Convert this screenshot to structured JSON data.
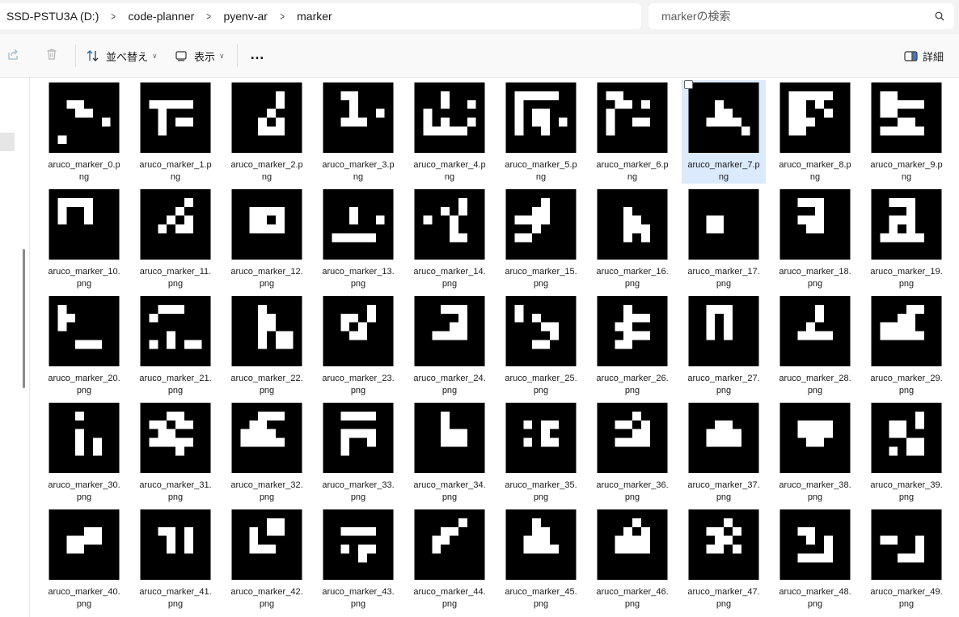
{
  "breadcrumb": [
    "SSD-PSTU3A (D:)",
    "code-planner",
    "pyenv-ar",
    "marker"
  ],
  "search": {
    "placeholder": "markerの検索"
  },
  "toolbar": {
    "sort_label": "並べ替え",
    "view_label": "表示",
    "more_label": "…",
    "details_label": "詳細"
  },
  "icons": {
    "share": "share-icon",
    "delete": "trash-icon",
    "sort": "sort-arrows-icon",
    "view": "view-icon",
    "details": "details-pane-icon",
    "search": "search-icon"
  },
  "selected_index": 7,
  "files": [
    {
      "line1": "aruco_marker_0.p",
      "line2": "ng",
      "g": "0000000000011000001100000001000000100000000000000000"
    },
    {
      "line1": "aruco_marker_1.p",
      "line2": "ng",
      "g": ""
    },
    {
      "line1": "aruco_marker_2.p",
      "line2": "ng",
      "g": ""
    },
    {
      "line1": "aruco_marker_3.p",
      "line2": "ng",
      "g": ""
    },
    {
      "line1": "aruco_marker_4.p",
      "line2": "ng",
      "g": ""
    },
    {
      "line1": "aruco_marker_5.p",
      "line2": "ng",
      "g": ""
    },
    {
      "line1": "aruco_marker_6.p",
      "line2": "ng",
      "g": ""
    },
    {
      "line1": "aruco_marker_7.p",
      "line2": "ng",
      "g": ""
    },
    {
      "line1": "aruco_marker_8.p",
      "line2": "ng",
      "g": ""
    },
    {
      "line1": "aruco_marker_9.p",
      "line2": "ng",
      "g": ""
    },
    {
      "line1": "aruco_marker_10.",
      "line2": "png",
      "g": ""
    },
    {
      "line1": "aruco_marker_11.",
      "line2": "png",
      "g": ""
    },
    {
      "line1": "aruco_marker_12.",
      "line2": "png",
      "g": ""
    },
    {
      "line1": "aruco_marker_13.",
      "line2": "png",
      "g": ""
    },
    {
      "line1": "aruco_marker_14.",
      "line2": "png",
      "g": ""
    },
    {
      "line1": "aruco_marker_15.",
      "line2": "png",
      "g": ""
    },
    {
      "line1": "aruco_marker_16.",
      "line2": "png",
      "g": ""
    },
    {
      "line1": "aruco_marker_17.",
      "line2": "png",
      "g": ""
    },
    {
      "line1": "aruco_marker_18.",
      "line2": "png",
      "g": ""
    },
    {
      "line1": "aruco_marker_19.",
      "line2": "png",
      "g": ""
    },
    {
      "line1": "aruco_marker_20.",
      "line2": "png",
      "g": ""
    },
    {
      "line1": "aruco_marker_21.",
      "line2": "png",
      "g": ""
    },
    {
      "line1": "aruco_marker_22.",
      "line2": "png",
      "g": ""
    },
    {
      "line1": "aruco_marker_23.",
      "line2": "png",
      "g": ""
    },
    {
      "line1": "aruco_marker_24.",
      "line2": "png",
      "g": ""
    },
    {
      "line1": "aruco_marker_25.",
      "line2": "png",
      "g": ""
    },
    {
      "line1": "aruco_marker_26.",
      "line2": "png",
      "g": ""
    },
    {
      "line1": "aruco_marker_27.",
      "line2": "png",
      "g": ""
    },
    {
      "line1": "aruco_marker_28.",
      "line2": "png",
      "g": ""
    },
    {
      "line1": "aruco_marker_29.",
      "line2": "png",
      "g": ""
    },
    {
      "line1": "aruco_marker_30.",
      "line2": "png",
      "g": ""
    },
    {
      "line1": "aruco_marker_31.",
      "line2": "png",
      "g": ""
    },
    {
      "line1": "aruco_marker_32.",
      "line2": "png",
      "g": ""
    },
    {
      "line1": "aruco_marker_33.",
      "line2": "png",
      "g": ""
    },
    {
      "line1": "aruco_marker_34.",
      "line2": "png",
      "g": ""
    },
    {
      "line1": "aruco_marker_35.",
      "line2": "png",
      "g": ""
    },
    {
      "line1": "aruco_marker_36.",
      "line2": "png",
      "g": ""
    },
    {
      "line1": "aruco_marker_37.",
      "line2": "png",
      "g": ""
    },
    {
      "line1": "aruco_marker_38.",
      "line2": "png",
      "g": ""
    },
    {
      "line1": "aruco_marker_39.",
      "line2": "png",
      "g": ""
    },
    {
      "line1": "aruco_marker_40.",
      "line2": "png",
      "g": ""
    },
    {
      "line1": "aruco_marker_41.",
      "line2": "png",
      "g": ""
    },
    {
      "line1": "aruco_marker_42.",
      "line2": "png",
      "g": ""
    },
    {
      "line1": "aruco_marker_43.",
      "line2": "png",
      "g": ""
    },
    {
      "line1": "aruco_marker_44.",
      "line2": "png",
      "g": ""
    },
    {
      "line1": "aruco_marker_45.",
      "line2": "png",
      "g": ""
    },
    {
      "line1": "aruco_marker_46.",
      "line2": "png",
      "g": ""
    },
    {
      "line1": "aruco_marker_47.",
      "line2": "png",
      "g": ""
    },
    {
      "line1": "aruco_marker_48.",
      "line2": "png",
      "g": ""
    },
    {
      "line1": "aruco_marker_49.",
      "line2": "png",
      "g": ""
    }
  ]
}
